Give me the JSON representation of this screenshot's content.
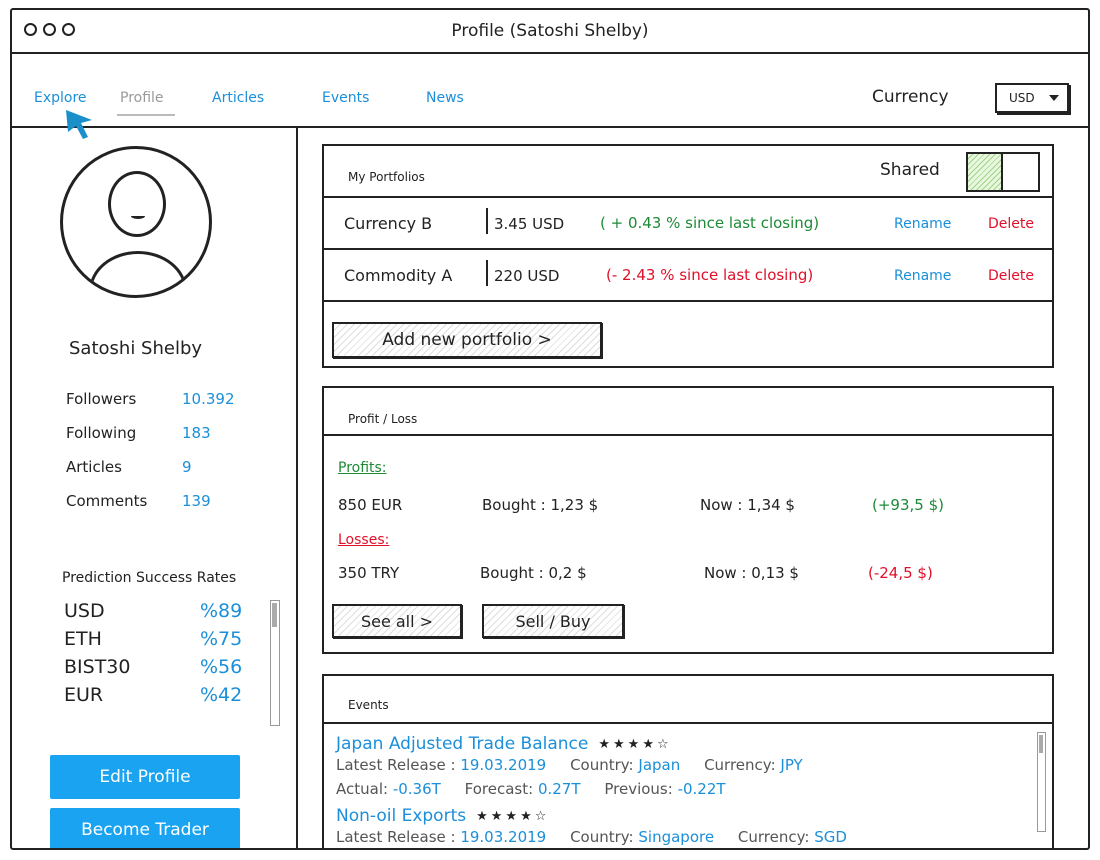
{
  "window": {
    "title": "Profile (Satoshi Shelby)"
  },
  "nav": {
    "items": [
      {
        "label": "Explore",
        "active": false
      },
      {
        "label": "Profile",
        "active": true
      },
      {
        "label": "Articles",
        "active": false
      },
      {
        "label": "Events",
        "active": false
      },
      {
        "label": "News",
        "active": false
      }
    ],
    "currency_label": "Currency",
    "currency_value": "USD"
  },
  "profile": {
    "name": "Satoshi Shelby",
    "stats": [
      {
        "label": "Followers",
        "value": "10.392"
      },
      {
        "label": "Following",
        "value": "183"
      },
      {
        "label": "Articles",
        "value": "9"
      },
      {
        "label": "Comments",
        "value": "139"
      }
    ],
    "rates_title": "Prediction Success Rates",
    "rates": [
      {
        "name": "USD",
        "value": "%89"
      },
      {
        "name": "ETH",
        "value": "%75"
      },
      {
        "name": "BIST30",
        "value": "%56"
      },
      {
        "name": "EUR",
        "value": "%42"
      }
    ],
    "edit_button": "Edit Profile",
    "trader_button": "Become Trader"
  },
  "portfolios": {
    "title": "My Portfolios",
    "shared_label": "Shared",
    "shared_on": true,
    "items": [
      {
        "name": "Currency B",
        "value": "3.45 USD",
        "change": "( + 0.43 % since last closing)",
        "trend": "up",
        "rename": "Rename",
        "delete": "Delete"
      },
      {
        "name": "Commodity A",
        "value": "220 USD",
        "change": "(- 2.43 % since last closing)",
        "trend": "down",
        "rename": "Rename",
        "delete": "Delete"
      }
    ],
    "add_button": "Add new portfolio >"
  },
  "profit_loss": {
    "title": "Profit / Loss",
    "profits_label": "Profits:",
    "losses_label": "Losses:",
    "profit_row": {
      "amount": "850 EUR",
      "bought": "Bought : 1,23 $",
      "now": "Now : 1,34 $",
      "delta": "(+93,5 $)"
    },
    "loss_row": {
      "amount": "350 TRY",
      "bought": "Bought : 0,2 $",
      "now": "Now : 0,13 $",
      "delta": "(-24,5 $)"
    },
    "see_all_button": "See all >",
    "sell_buy_button": "Sell / Buy"
  },
  "events": {
    "title": "Events",
    "items": [
      {
        "name": "Japan Adjusted Trade Balance",
        "stars": "★★★★☆",
        "release_label": "Latest Release : ",
        "release": "19.03.2019",
        "country_label": "Country: ",
        "country": "Japan",
        "currency_label": "Currency: ",
        "currency": "JPY",
        "actual_label": "Actual: ",
        "actual": "-0.36T",
        "forecast_label": "Forecast: ",
        "forecast": "0.27T",
        "previous_label": "Previous: ",
        "previous": "-0.22T"
      },
      {
        "name": "Non-oil Exports",
        "stars": "★★★★☆",
        "release_label": "Latest Release : ",
        "release": "19.03.2019",
        "country_label": "Country: ",
        "country": "Singapore",
        "currency_label": "Currency: ",
        "currency": "SGD"
      }
    ]
  }
}
